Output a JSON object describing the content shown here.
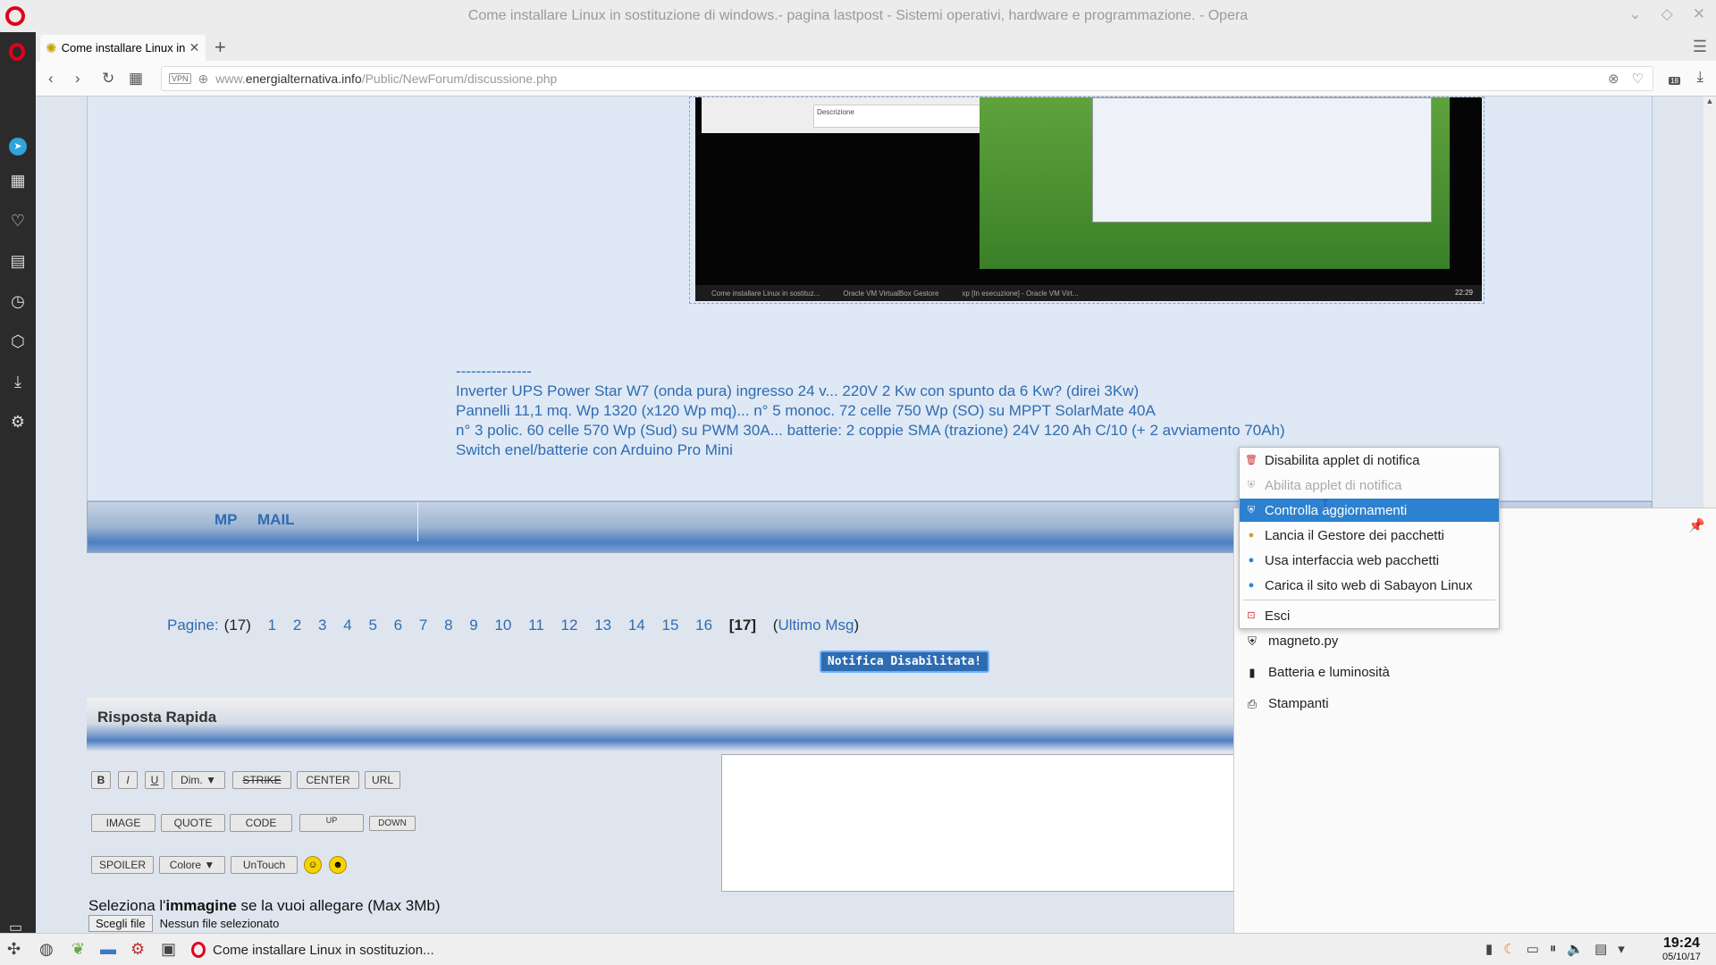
{
  "window": {
    "title": "Come installare Linux in sostituzione di windows.- pagina lastpost - Sistemi operativi, hardware e programmazione. - Opera"
  },
  "tab": {
    "title": "Come installare Linux in sostituzione di windows.- pagina lastpost"
  },
  "address": {
    "url_prefix": "www.",
    "url_domain": "energialternativa.info",
    "url_path": "/Public/NewForum/discussione.php",
    "vpn": "VPN",
    "badge": "18"
  },
  "screenshot_thumb": {
    "window_title": "Descrizione",
    "time": "22:29",
    "taskbar1": "Come installare Linux in sostituz...",
    "taskbar2": "Oracle VM VirtualBox Gestore",
    "taskbar3": "xp [In esecuzione] - Oracle VM Virt..."
  },
  "signature": {
    "dashes": "---------------",
    "line1": "Inverter UPS Power Star W7 (onda pura) ingresso 24 v... 220V 2 Kw con spunto da 6 Kw? (direi 3Kw)",
    "line2": "Pannelli 11,1 mq. Wp 1320 (x120 Wp mq)... n° 5 monoc. 72 celle 750 Wp (SO) su MPPT SolarMate 40A",
    "line3": "n° 3 polic. 60 celle 570 Wp (Sud) su PWM 30A... batterie: 2 coppie SMA (trazione) 24V 120 Ah C/10 (+ 2 avviamento 70Ah)",
    "line4": "Switch enel/batterie con Arduino Pro Mini"
  },
  "post_links": {
    "mp": "MP",
    "mail": "MAIL"
  },
  "pager": {
    "label": "Pagine:",
    "total": "(17)",
    "pages": [
      "1",
      "2",
      "3",
      "4",
      "5",
      "6",
      "7",
      "8",
      "9",
      "10",
      "11",
      "12",
      "13",
      "14",
      "15",
      "16"
    ],
    "current": "[17]",
    "last_open": "(",
    "last": "Ultimo Msg",
    "last_close": ")"
  },
  "notify_button": "Notifica Disabilitata!",
  "quick_reply": {
    "title": "Risposta Rapida",
    "buttons": {
      "bold": "B",
      "italic": "I",
      "underline": "U",
      "size": "Dim.",
      "strike": "STRIKE",
      "center": "CENTER",
      "url": "URL",
      "image": "IMAGE",
      "quote": "QUOTE",
      "code": "CODE",
      "up": "UP",
      "down": "DOWN",
      "spoiler": "SPOILER",
      "color": "Colore",
      "untouch": "UnTouch"
    },
    "attach_pre": "Seleziona l'",
    "attach_bold": "immagine",
    "attach_post": " se la vuoi allegare (Max 3Mb)",
    "file_button": "Scegli file",
    "file_status": "Nessun file selezionato"
  },
  "context_menu": {
    "items": [
      {
        "label": "Disabilita applet di notifica",
        "state": "normal"
      },
      {
        "label": "Abilita applet di notifica",
        "state": "disabled"
      },
      {
        "label": "Controlla aggiornamenti",
        "state": "highlighted"
      },
      {
        "label": "Lancia il Gestore dei pacchetti",
        "state": "normal"
      },
      {
        "label": "Usa interfaccia web pacchetti",
        "state": "normal"
      },
      {
        "label": "Carica il sito web di Sabayon Linux",
        "state": "normal"
      },
      {
        "label": "Esci",
        "state": "normal"
      }
    ]
  },
  "tray_panel": {
    "items": [
      "magneto.py",
      "Batteria e luminosità",
      "Stampanti"
    ]
  },
  "taskbar": {
    "app_title": "Come installare Linux in sostituzion...",
    "time": "19:24",
    "date": "05/10/17"
  },
  "colors": {
    "link": "#2e6cb2",
    "highlight": "#2c81d0",
    "opera_red": "#e0001b"
  }
}
